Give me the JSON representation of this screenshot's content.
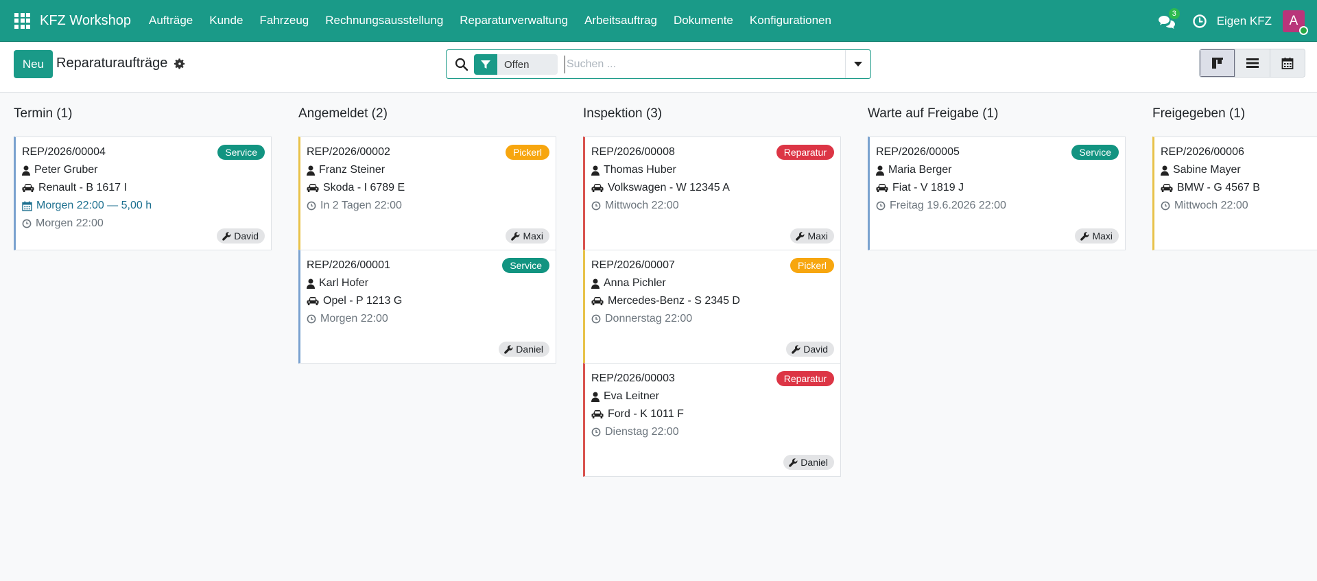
{
  "navbar": {
    "brand": "KFZ Workshop",
    "menu": [
      "Aufträge",
      "Kunde",
      "Fahrzeug",
      "Rechnungsausstellung",
      "Reparaturverwaltung",
      "Arbeitsauftrag",
      "Dokumente",
      "Konfigurationen"
    ],
    "chat_count": "3",
    "company": "Eigen KFZ",
    "avatar_letter": "A"
  },
  "control": {
    "new_label": "Neu",
    "title": "Reparaturaufträge",
    "facet_label": "Offen",
    "search_placeholder": "Suchen ..."
  },
  "colors": {
    "primary": "#1a9a88",
    "service": "#129481",
    "pickerl": "#f7a60f",
    "reparatur": "#dc3545",
    "border_blue": "#7aa2cf",
    "border_yellow": "#e8c24a",
    "border_red": "#d9534f"
  },
  "columns": [
    {
      "title": "Termin (1)",
      "cards": [
        {
          "ref": "REP/2026/00004",
          "tag": "Service",
          "tag_type": "service",
          "border": "blue",
          "customer": "Peter Gruber",
          "vehicle": "Renault - B 1617 I",
          "appointment": "Morgen 22:00 — 5,00 h",
          "deadline": "Morgen 22:00",
          "mechanic": "David"
        }
      ]
    },
    {
      "title": "Angemeldet (2)",
      "cards": [
        {
          "ref": "REP/2026/00002",
          "tag": "Pickerl",
          "tag_type": "pickerl",
          "border": "yellow",
          "customer": "Franz Steiner",
          "vehicle": "Skoda - I 6789 E",
          "deadline": "In 2 Tagen 22:00",
          "mechanic": "Maxi"
        },
        {
          "ref": "REP/2026/00001",
          "tag": "Service",
          "tag_type": "service",
          "border": "blue",
          "customer": "Karl Hofer",
          "vehicle": "Opel - P 1213 G",
          "deadline": "Morgen 22:00",
          "mechanic": "Daniel"
        }
      ]
    },
    {
      "title": "Inspektion (3)",
      "cards": [
        {
          "ref": "REP/2026/00008",
          "tag": "Reparatur",
          "tag_type": "reparatur",
          "border": "red",
          "customer": "Thomas Huber",
          "vehicle": "Volkswagen - W 12345 A",
          "deadline": "Mittwoch 22:00",
          "mechanic": "Maxi"
        },
        {
          "ref": "REP/2026/00007",
          "tag": "Pickerl",
          "tag_type": "pickerl",
          "border": "yellow",
          "customer": "Anna Pichler",
          "vehicle": "Mercedes-Benz - S 2345 D",
          "deadline": "Donnerstag 22:00",
          "mechanic": "David"
        },
        {
          "ref": "REP/2026/00003",
          "tag": "Reparatur",
          "tag_type": "reparatur",
          "border": "red",
          "customer": "Eva Leitner",
          "vehicle": "Ford - K 1011 F",
          "deadline": "Dienstag 22:00",
          "mechanic": "Daniel"
        }
      ]
    },
    {
      "title": "Warte auf Freigabe (1)",
      "cards": [
        {
          "ref": "REP/2026/00005",
          "tag": "Service",
          "tag_type": "service",
          "border": "blue",
          "customer": "Maria Berger",
          "vehicle": "Fiat - V 1819 J",
          "deadline": "Freitag 19.6.2026 22:00",
          "mechanic": "Maxi"
        }
      ]
    },
    {
      "title": "Freigegeben (1)",
      "cards": [
        {
          "ref": "REP/2026/00006",
          "tag": "",
          "tag_type": "",
          "border": "yellow",
          "customer": "Sabine Mayer",
          "vehicle": "BMW - G 4567 B",
          "deadline": "Mittwoch 22:00",
          "mechanic": ""
        }
      ]
    }
  ]
}
